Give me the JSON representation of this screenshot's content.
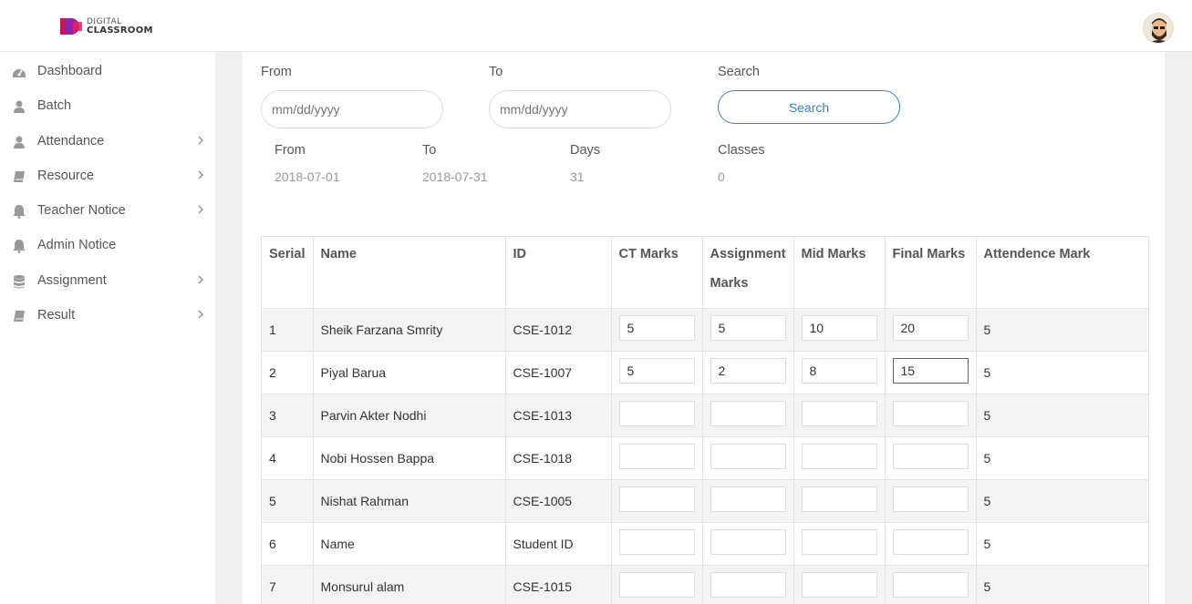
{
  "brand": {
    "line1": "DIGITAL",
    "line2": "CLASSROOM",
    "colors": {
      "magenta": "#c2185b",
      "purple": "#6a1b9a",
      "accent": "#3b87c9"
    }
  },
  "sidebar": {
    "items": [
      {
        "label": "Dashboard",
        "icon": "dashboard-icon",
        "has_children": false
      },
      {
        "label": "Batch",
        "icon": "user-icon",
        "has_children": false
      },
      {
        "label": "Attendance",
        "icon": "user-icon",
        "has_children": true
      },
      {
        "label": "Resource",
        "icon": "book-icon",
        "has_children": true
      },
      {
        "label": "Teacher Notice",
        "icon": "bell-icon",
        "has_children": true
      },
      {
        "label": "Admin Notice",
        "icon": "bell-icon",
        "has_children": false
      },
      {
        "label": "Assignment",
        "icon": "database-icon",
        "has_children": true
      },
      {
        "label": "Result",
        "icon": "book-icon",
        "has_children": true
      }
    ]
  },
  "filter": {
    "from_label": "From",
    "from_placeholder": "mm/dd/yyyy",
    "to_label": "To",
    "to_placeholder": "mm/dd/yyyy",
    "search_label": "Search",
    "search_button": "Search"
  },
  "summary": {
    "from_label": "From",
    "from_value": "2018-07-01",
    "to_label": "To",
    "to_value": "2018-07-31",
    "days_label": "Days",
    "days_value": "31",
    "classes_label": "Classes",
    "classes_value": "0"
  },
  "table": {
    "headers": [
      "Serial",
      "Name",
      "ID",
      "CT Marks",
      "Assignment Marks",
      "Mid Marks",
      "Final Marks",
      "Attendence Mark"
    ],
    "rows": [
      {
        "serial": "1",
        "name": "Sheik Farzana Smrity",
        "id": "CSE-1012",
        "ct": "5",
        "assignment": "5",
        "mid": "10",
        "final": "20",
        "attendance": "5"
      },
      {
        "serial": "2",
        "name": "Piyal Barua",
        "id": "CSE-1007",
        "ct": "5",
        "assignment": "2",
        "mid": "8",
        "final": "15",
        "attendance": "5"
      },
      {
        "serial": "3",
        "name": "Parvin Akter Nodhi",
        "id": "CSE-1013",
        "ct": "",
        "assignment": "",
        "mid": "",
        "final": "",
        "attendance": "5"
      },
      {
        "serial": "4",
        "name": "Nobi Hossen Bappa",
        "id": "CSE-1018",
        "ct": "",
        "assignment": "",
        "mid": "",
        "final": "",
        "attendance": "5"
      },
      {
        "serial": "5",
        "name": "Nishat Rahman",
        "id": "CSE-1005",
        "ct": "",
        "assignment": "",
        "mid": "",
        "final": "",
        "attendance": "5"
      },
      {
        "serial": "6",
        "name": "Name",
        "id": "Student ID",
        "ct": "",
        "assignment": "",
        "mid": "",
        "final": "",
        "attendance": "5"
      },
      {
        "serial": "7",
        "name": "Monsurul alam",
        "id": "CSE-1015",
        "ct": "",
        "assignment": "",
        "mid": "",
        "final": "",
        "attendance": "5"
      }
    ]
  }
}
